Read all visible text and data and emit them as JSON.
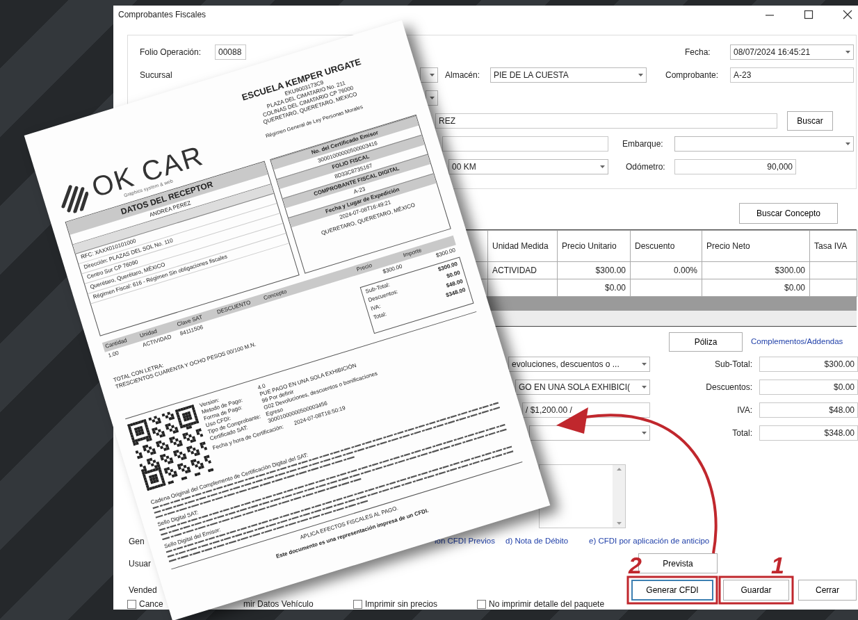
{
  "window": {
    "title": "Comprobantes Fiscales"
  },
  "header": {
    "folio_label": "Folio Operación:",
    "folio": "00088",
    "fecha_label": "Fecha:",
    "fecha": "08/07/2024 16:45:21",
    "sucursal_label": "Sucursal",
    "almacen_label": "Almacén:",
    "almacen": "PIE DE LA CUESTA",
    "comprobante_label": "Comprobante:",
    "comprobante": "A-23",
    "cliente": "REZ",
    "buscar": "Buscar",
    "embarque_label": "Embarque:",
    "vehiculo": "00 KM",
    "odometro_label": "Odómetro:",
    "odometro": "90,000"
  },
  "buscar_concepto": "Buscar Concepto",
  "table": {
    "columns": [
      "Unidad Medida",
      "Precio Unitario",
      "Descuento",
      "Precio Neto",
      "Tasa IVA"
    ],
    "rows": [
      {
        "unidad_medida": "ACTIVIDAD",
        "precio_unitario": "$300.00",
        "descuento": "0.00%",
        "precio_neto": "$300.00"
      },
      {
        "precio_unitario": "$0.00",
        "precio_neto": "$0.00"
      }
    ]
  },
  "poliza": "Póliza",
  "complementos": "Complementos/Addendas",
  "selects": [
    {
      "kind": "dropdown",
      "value": "evoluciones, descuentos o ..."
    },
    {
      "kind": "dropdown",
      "value": "GO EN UNA SOLA EXHIBICI("
    },
    {
      "kind": "field",
      "value": "/ $1,200.00 /"
    },
    {
      "kind": "dropdown"
    }
  ],
  "totals": [
    {
      "label": "Sub-Total:",
      "value": "$300.00"
    },
    {
      "label": "Descuentos:",
      "value": "$0.00"
    },
    {
      "label": "IVA:",
      "value": "$48.00"
    },
    {
      "label": "Total:",
      "value": "$348.00"
    }
  ],
  "gen_label": "Gen",
  "links": [
    "ion CFDI Previos",
    "d) Nota de Débito",
    "e) CFDI por aplicación de anticipo"
  ],
  "usuario_label": "Usuar",
  "prevista": "Prevista",
  "vendedor_label": "Vended",
  "buttons": [
    {
      "label": "Generar CFDI",
      "focused": true,
      "annotation": "2"
    },
    {
      "label": "Guardar",
      "focused": false,
      "annotation": "1"
    },
    {
      "label": "Cerrar",
      "focused": false
    }
  ],
  "checkboxes": [
    {
      "label": "Cance",
      "checked": false
    },
    {
      "kind": "fragment",
      "label": "mir Datos Vehículo"
    },
    {
      "label": "Imprimir sin precios",
      "checked": false
    },
    {
      "label": "No imprimir detalle del paquete",
      "checked": false
    }
  ],
  "document": {
    "logo": "OK CAR",
    "logo_tagline": "Graphics system & web",
    "issuer": {
      "name": "ESCUELA KEMPER URGATE",
      "lines": [
        "EKU9003173C9",
        "PLAZA DEL CIMATARIO No. 211",
        "COLINAS DEL CIMATARIO CP 76000",
        "QUERETARO, QUERETARO, MEXICO"
      ],
      "regime": "Régimen General de Ley Personas Morales"
    },
    "receptor": {
      "title": "DATOS DEL RECEPTOR",
      "name": "ANDREA PEREZ",
      "lines": [
        "RFC:  XAXX010101000",
        "Dirección:  PLAZAS DEL SOL No. 110",
        "Centro Sur CP 76090",
        "Querétaro, Querétaro, MÉXICO",
        "Régimen Fiscal: 616 - Régimen Sin obligaciones fiscales"
      ]
    },
    "certificate": [
      {
        "kind": "heading",
        "text": "No. del Certificado Emisor"
      },
      {
        "kind": "value",
        "text": "30001000000500003416"
      },
      {
        "kind": "heading",
        "text": "FOLIO FISCAL"
      },
      {
        "kind": "value",
        "text": "8D33C8735167"
      },
      {
        "kind": "heading",
        "text": "COMPROBANTE FISCAL DIGITAL"
      },
      {
        "kind": "value",
        "text": "A-23"
      },
      {
        "kind": "heading",
        "text": "Fecha y Lugar de Expedición"
      },
      {
        "kind": "value",
        "text": "2024-07-08T16:49:21"
      },
      {
        "kind": "value",
        "text": "QUERETARO, QUERETARO, MÉXICO"
      }
    ],
    "concept_columns": [
      "Cantidad",
      "Unidad",
      "Clave SAT",
      "DESCUENTO",
      "Concepto",
      "Precio",
      "Importe"
    ],
    "concept_row": [
      "1.00",
      "ACTIVIDAD",
      "84111506",
      "$300.00",
      "$300.00"
    ],
    "total_labels": [
      "Sub-Total:",
      "Descuentos:",
      "IVA:",
      "Total:"
    ],
    "total_values": [
      "$300.00",
      "$0.00",
      "$48.00",
      "$348.00"
    ],
    "amount_words_label": "TOTAL CON LETRA:",
    "amount_words": "TRESCIENTOS CUARENTA Y OCHO PESOS 00/100 M.N.",
    "cfdi_labels": [
      "Version:",
      "Metodo de Pago:",
      "Forma de Pago:",
      "Uso CFDI:",
      "Tipo de Comprobante:",
      "Certificado SAT:"
    ],
    "cfdi_values": [
      "4.0",
      "PUE  PAGO EN UNA SOLA EXHIBICIÓN",
      "99  Por definir",
      "G02  Devoluciones, descuentos o bonificaciones",
      "Egreso",
      "30001000000500003456"
    ],
    "certification_label": "Fecha y hora de Certificación:",
    "certification_date": "2024-07-08T16:50:19",
    "seals": [
      "Cadena Original del Complemento de Certificación Digital del SAT:",
      "Sello Digital SAT:",
      "Sello Digital del Emisor:"
    ],
    "footer": [
      "APLICA EFECTOS FISCALES AL PAGO.",
      "Este documento es una representación impresa de un CFDI."
    ]
  }
}
